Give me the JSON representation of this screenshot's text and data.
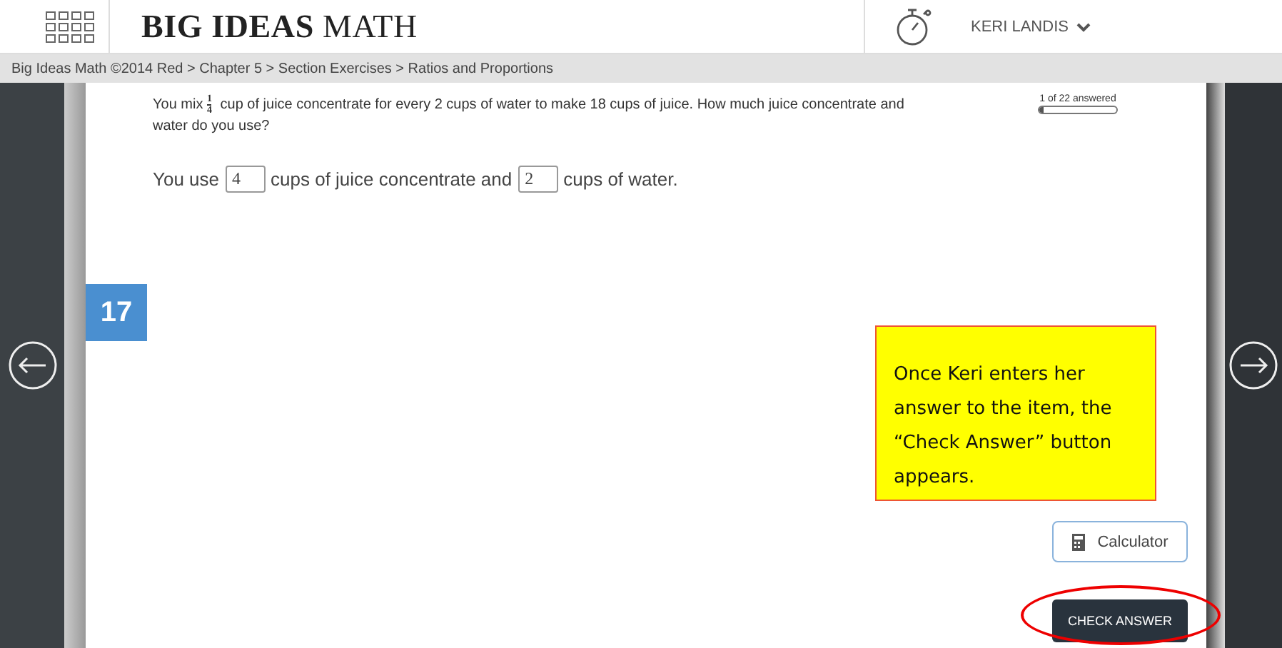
{
  "header": {
    "logo_bold": "BIG IDEAS",
    "logo_light": "MATH",
    "user": "KERI LANDIS"
  },
  "breadcrumb": "Big Ideas Math ©2014 Red > Chapter 5 > Section Exercises > Ratios and Proportions",
  "question": {
    "text_before": "You mix",
    "fraction": {
      "numerator": "1",
      "denominator": "4"
    },
    "text_after": "cup of juice concentrate for every 2 cups of water to make 18 cups of juice. How much juice concentrate and water do you use?",
    "answer_parts": [
      {
        "kind": "text",
        "text": "You use"
      },
      {
        "kind": "field",
        "value": "4"
      },
      {
        "kind": "text",
        "text": "cups of juice concentrate and"
      },
      {
        "kind": "field",
        "value": "2"
      },
      {
        "kind": "text",
        "text": "cups of water."
      }
    ]
  },
  "progress": {
    "label": "1 of 22 answered",
    "level": 0.05
  },
  "item_number": "17",
  "calculator_button": "Calculator",
  "check_answer_button": "CHECK ANSWER",
  "callout": {
    "text": "Once Keri enters her answer to the item, the “Check Answer” button appears."
  }
}
